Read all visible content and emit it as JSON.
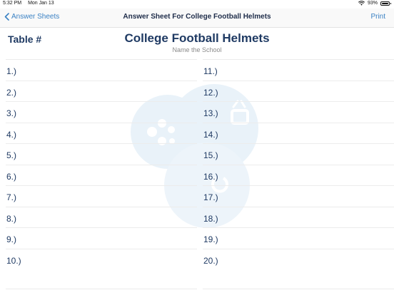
{
  "status_bar": {
    "time": "5:32 PM",
    "date": "Mon Jan 13",
    "battery": "93%",
    "icons": [
      "wifi-icon",
      "battery-icon"
    ]
  },
  "nav": {
    "back_label": "Answer Sheets",
    "title": "Answer Sheet For College Football Helmets",
    "print_label": "Print",
    "back_icon": "chevron-left-icon"
  },
  "header": {
    "table_label": "Table #",
    "title": "College Football Helmets",
    "subtitle": "Name the School"
  },
  "answers": {
    "left": [
      "1.)",
      "2.)",
      "3.)",
      "4.)",
      "5.)",
      "6.)",
      "7.)",
      "8.)",
      "9.)",
      "10.)"
    ],
    "right": [
      "11.)",
      "12.)",
      "13.)",
      "14.)",
      "15.)",
      "16.)",
      "17.)",
      "18.)",
      "19.)",
      "20.)"
    ]
  },
  "colors": {
    "accent": "#3b82c4",
    "heading": "#1f3a63",
    "watermark": "#e6f0f8"
  }
}
